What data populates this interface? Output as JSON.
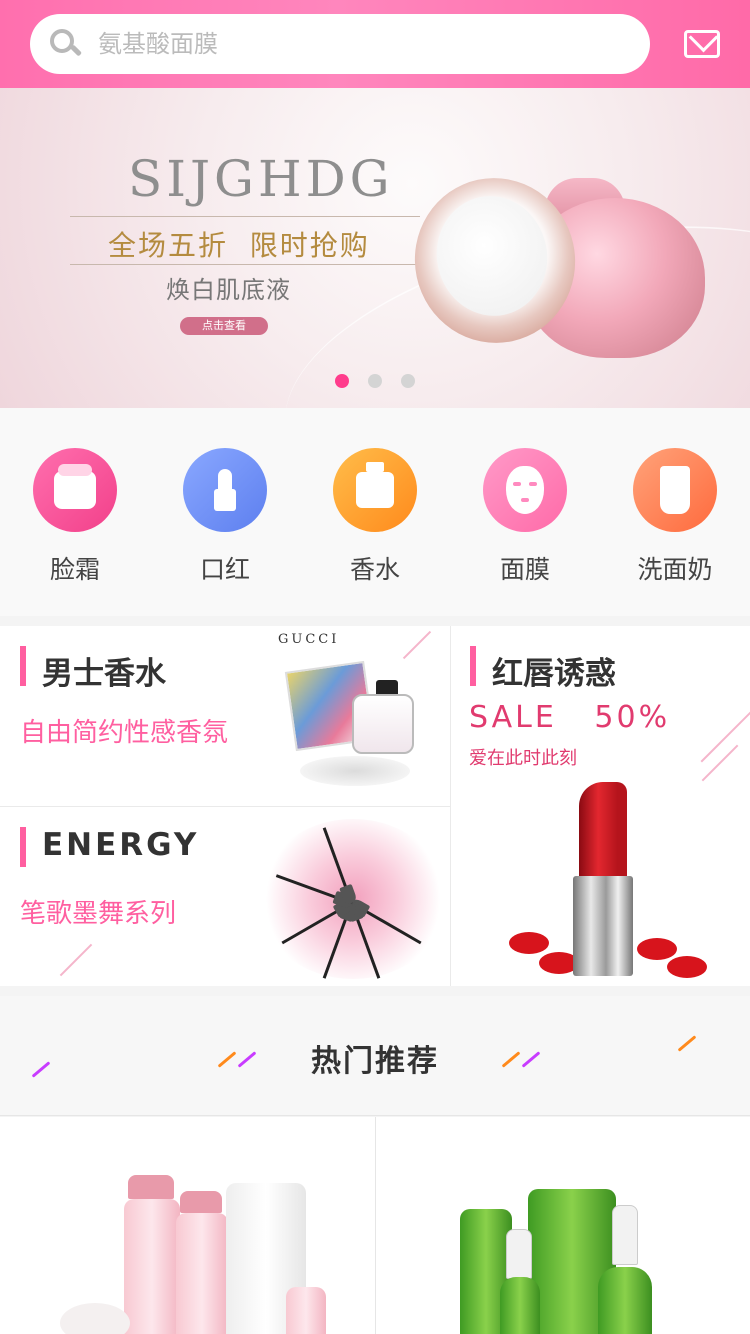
{
  "header": {
    "search_placeholder": "氨基酸面膜",
    "icons": [
      "search-icon",
      "mail-icon"
    ]
  },
  "banner": {
    "brand": "SIJGHDG",
    "tagline": "全场五折  限时抢购",
    "subtitle": "焕白肌底液",
    "button_label": "点击查看",
    "slides": 3,
    "active_slide": 1
  },
  "categories": [
    {
      "label": "脸霜",
      "icon": "face-cream-icon"
    },
    {
      "label": "口红",
      "icon": "lipstick-icon"
    },
    {
      "label": "香水",
      "icon": "perfume-icon"
    },
    {
      "label": "面膜",
      "icon": "face-mask-icon"
    },
    {
      "label": "洗面奶",
      "icon": "cleanser-icon"
    }
  ],
  "promos": {
    "mens_perfume": {
      "title": "男士香水",
      "subtitle": "自由简约性感香氛",
      "brand": "GUCCI"
    },
    "energy": {
      "title": "ENERGY",
      "subtitle": "笔歌墨舞系列"
    },
    "lips": {
      "title": "红唇诱惑",
      "sale": "SALE   50%",
      "subtitle": "爱在此时此刻"
    }
  },
  "hot": {
    "title": "热门推荐"
  },
  "colors": {
    "accent": "#ff5fa0",
    "header": "#ff7ab5",
    "active_dot": "#ff3c8c"
  }
}
